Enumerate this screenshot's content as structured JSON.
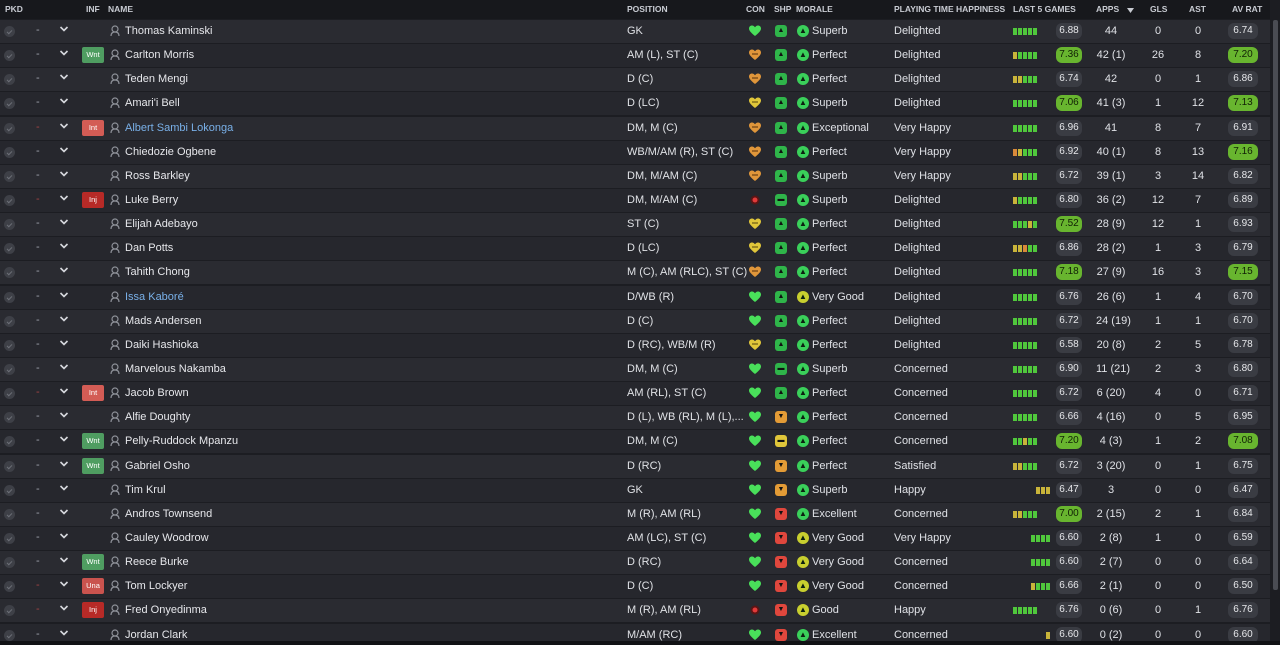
{
  "headers": {
    "pkd": "PKD",
    "inf": "INF",
    "name": "NAME",
    "position": "POSITION",
    "con": "CON",
    "shp": "SHP",
    "morale": "MORALE",
    "pth": "PLAYING TIME HAPPINESS",
    "form": "LAST 5 GAMES",
    "apps": "APPS",
    "sort_icon": "sort-desc-icon",
    "gls": "GLS",
    "ast": "AST",
    "avrat": "AV RAT"
  },
  "colors": {
    "form_green": "#50c83c",
    "form_yellow": "#c9b43a",
    "form_orange": "#d98a3a",
    "highlight_rating": "#68b52f",
    "link_name": "#79b0e8"
  },
  "players": [
    {
      "sel": "-",
      "inf": "",
      "name": "Thomas Kaminski",
      "link": false,
      "pos": "GK",
      "con": "heart-green",
      "shp": "up-green",
      "mor": "Superb",
      "mor_icon": "up-green",
      "pth": "Delighted",
      "form": [
        "g",
        "g",
        "g",
        "g",
        "g"
      ],
      "fval": "6.88",
      "fhi": false,
      "apps": "44",
      "gls": "0",
      "ast": "0",
      "rat": "6.74",
      "rhi": false
    },
    {
      "sel": "-",
      "inf": "Wnt",
      "name": "Carlton Morris",
      "link": false,
      "pos": "AM (L), ST (C)",
      "con": "heart-orange",
      "shp": "up-green",
      "mor": "Perfect",
      "mor_icon": "up-up-green",
      "pth": "Delighted",
      "form": [
        "y",
        "g",
        "g",
        "g",
        "g"
      ],
      "fval": "7.36",
      "fhi": true,
      "apps": "42 (1)",
      "gls": "26",
      "ast": "8",
      "rat": "7.20",
      "rhi": true
    },
    {
      "sel": "-",
      "inf": "",
      "name": "Teden Mengi",
      "link": false,
      "pos": "D (C)",
      "con": "heart-orange",
      "shp": "up-green",
      "mor": "Perfect",
      "mor_icon": "up-up-green",
      "pth": "Delighted",
      "form": [
        "y",
        "y",
        "g",
        "g",
        "g"
      ],
      "fval": "6.74",
      "fhi": false,
      "apps": "42",
      "gls": "0",
      "ast": "1",
      "rat": "6.86",
      "rhi": false
    },
    {
      "sel": "-",
      "inf": "",
      "name": "Amari'i Bell",
      "link": false,
      "pos": "D (LC)",
      "con": "heart-yellow",
      "shp": "up-green",
      "mor": "Superb",
      "mor_icon": "up-green",
      "pth": "Delighted",
      "form": [
        "g",
        "g",
        "g",
        "g",
        "g"
      ],
      "fval": "7.06",
      "fhi": true,
      "apps": "41 (3)",
      "gls": "1",
      "ast": "12",
      "rat": "7.13",
      "rhi": true
    },
    {
      "sel": "-",
      "inf": "Int",
      "name": "Albert Sambi Lokonga",
      "link": true,
      "pos": "DM, M (C)",
      "con": "heart-orange",
      "shp": "up-green",
      "mor": "Exceptional",
      "mor_icon": "up-up-green",
      "pth": "Very Happy",
      "form": [
        "g",
        "g",
        "g",
        "g",
        "g"
      ],
      "fval": "6.96",
      "fhi": false,
      "apps": "41",
      "gls": "8",
      "ast": "7",
      "rat": "6.91",
      "rhi": false
    },
    {
      "sel": "-",
      "inf": "",
      "name": "Chiedozie Ogbene",
      "link": false,
      "pos": "WB/M/AM (R), ST (C)",
      "con": "heart-orange",
      "shp": "up-green",
      "mor": "Perfect",
      "mor_icon": "up-up-green",
      "pth": "Very Happy",
      "form": [
        "o",
        "y",
        "g",
        "g",
        "g"
      ],
      "fval": "6.92",
      "fhi": false,
      "apps": "40 (1)",
      "gls": "8",
      "ast": "13",
      "rat": "7.16",
      "rhi": true
    },
    {
      "sel": "-",
      "inf": "",
      "name": "Ross Barkley",
      "link": false,
      "pos": "DM, M/AM (C)",
      "con": "heart-orange",
      "shp": "up-green",
      "mor": "Superb",
      "mor_icon": "up-green",
      "pth": "Very Happy",
      "form": [
        "y",
        "y",
        "g",
        "g",
        "g"
      ],
      "fval": "6.72",
      "fhi": false,
      "apps": "39 (1)",
      "gls": "3",
      "ast": "14",
      "rat": "6.82",
      "rhi": false
    },
    {
      "sel": "-",
      "inf": "Inj",
      "name": "Luke Berry",
      "link": false,
      "pos": "DM, M/AM (C)",
      "con": "injury-red",
      "shp": "flat-green",
      "mor": "Superb",
      "mor_icon": "up-green",
      "pth": "Delighted",
      "form": [
        "y",
        "g",
        "g",
        "g",
        "g"
      ],
      "fval": "6.80",
      "fhi": false,
      "apps": "36 (2)",
      "gls": "12",
      "ast": "7",
      "rat": "6.89",
      "rhi": false
    },
    {
      "sel": "-",
      "inf": "",
      "name": "Elijah Adebayo",
      "link": false,
      "pos": "ST (C)",
      "con": "heart-yellow",
      "shp": "up-green",
      "mor": "Perfect",
      "mor_icon": "up-up-green",
      "pth": "Delighted",
      "form": [
        "g",
        "g",
        "g",
        "y",
        "g"
      ],
      "fval": "7.52",
      "fhi": true,
      "apps": "28 (9)",
      "gls": "12",
      "ast": "1",
      "rat": "6.93",
      "rhi": false
    },
    {
      "sel": "-",
      "inf": "",
      "name": "Dan Potts",
      "link": false,
      "pos": "D (LC)",
      "con": "heart-yellow",
      "shp": "up-green",
      "mor": "Perfect",
      "mor_icon": "up-up-green",
      "pth": "Delighted",
      "form": [
        "y",
        "y",
        "o",
        "g",
        "g"
      ],
      "fval": "6.86",
      "fhi": false,
      "apps": "28 (2)",
      "gls": "1",
      "ast": "3",
      "rat": "6.79",
      "rhi": false
    },
    {
      "sel": "-",
      "inf": "",
      "name": "Tahith Chong",
      "link": false,
      "pos": "M (C), AM (RLC), ST (C)",
      "con": "heart-orange",
      "shp": "up-green",
      "mor": "Perfect",
      "mor_icon": "up-up-green",
      "pth": "Delighted",
      "form": [
        "g",
        "g",
        "g",
        "g",
        "g"
      ],
      "fval": "7.18",
      "fhi": true,
      "apps": "27 (9)",
      "gls": "16",
      "ast": "3",
      "rat": "7.15",
      "rhi": true
    },
    {
      "sel": "-",
      "inf": "",
      "name": "Issa Kaboré",
      "link": true,
      "pos": "D/WB (R)",
      "con": "heart-green",
      "shp": "up-green",
      "mor": "Very Good",
      "mor_icon": "up-yellow",
      "pth": "Delighted",
      "form": [
        "g",
        "g",
        "g",
        "g",
        "g"
      ],
      "fval": "6.76",
      "fhi": false,
      "apps": "26 (6)",
      "gls": "1",
      "ast": "4",
      "rat": "6.70",
      "rhi": false
    },
    {
      "sel": "-",
      "inf": "",
      "name": "Mads Andersen",
      "link": false,
      "pos": "D (C)",
      "con": "heart-green",
      "shp": "up-green",
      "mor": "Perfect",
      "mor_icon": "up-up-green",
      "pth": "Delighted",
      "form": [
        "g",
        "g",
        "g",
        "g",
        "g"
      ],
      "fval": "6.72",
      "fhi": false,
      "apps": "24 (19)",
      "gls": "1",
      "ast": "1",
      "rat": "6.70",
      "rhi": false
    },
    {
      "sel": "-",
      "inf": "",
      "name": "Daiki Hashioka",
      "link": false,
      "pos": "D (RC), WB/M (R)",
      "con": "heart-yellow",
      "shp": "up-green",
      "mor": "Perfect",
      "mor_icon": "up-up-green",
      "pth": "Delighted",
      "form": [
        "g",
        "g",
        "g",
        "g",
        "g"
      ],
      "fval": "6.58",
      "fhi": false,
      "apps": "20 (8)",
      "gls": "2",
      "ast": "5",
      "rat": "6.78",
      "rhi": false
    },
    {
      "sel": "-",
      "inf": "",
      "name": "Marvelous Nakamba",
      "link": false,
      "pos": "DM, M (C)",
      "con": "heart-green",
      "shp": "flat-green",
      "mor": "Superb",
      "mor_icon": "up-green",
      "pth": "Concerned",
      "form": [
        "g",
        "g",
        "g",
        "g",
        "g"
      ],
      "fval": "6.90",
      "fhi": false,
      "apps": "11 (21)",
      "gls": "2",
      "ast": "3",
      "rat": "6.80",
      "rhi": false
    },
    {
      "sel": "-",
      "inf": "Int",
      "name": "Jacob Brown",
      "link": false,
      "pos": "AM (RL), ST (C)",
      "con": "heart-green",
      "shp": "up-green",
      "mor": "Perfect",
      "mor_icon": "up-up-green",
      "pth": "Concerned",
      "form": [
        "g",
        "g",
        "g",
        "g",
        "g"
      ],
      "fval": "6.72",
      "fhi": false,
      "apps": "6 (20)",
      "gls": "4",
      "ast": "0",
      "rat": "6.71",
      "rhi": false
    },
    {
      "sel": "-",
      "inf": "",
      "name": "Alfie Doughty",
      "link": false,
      "pos": "D (L), WB (RL), M (L),...",
      "con": "heart-green",
      "shp": "down-orange",
      "mor": "Perfect",
      "mor_icon": "up-up-green",
      "pth": "Concerned",
      "form": [
        "g",
        "g",
        "g",
        "g",
        "g"
      ],
      "fval": "6.66",
      "fhi": false,
      "apps": "4 (16)",
      "gls": "0",
      "ast": "5",
      "rat": "6.95",
      "rhi": false
    },
    {
      "sel": "-",
      "inf": "Wnt",
      "name": "Pelly-Ruddock Mpanzu",
      "link": false,
      "pos": "DM, M (C)",
      "con": "heart-green",
      "shp": "flat-yellow",
      "mor": "Perfect",
      "mor_icon": "up-up-green",
      "pth": "Concerned",
      "form": [
        "g",
        "g",
        "y",
        "g",
        "g"
      ],
      "fval": "7.20",
      "fhi": true,
      "apps": "4 (3)",
      "gls": "1",
      "ast": "2",
      "rat": "7.08",
      "rhi": true
    },
    {
      "sel": "-",
      "inf": "Wnt",
      "name": "Gabriel Osho",
      "link": false,
      "pos": "D (RC)",
      "con": "heart-green",
      "shp": "down-orange",
      "mor": "Perfect",
      "mor_icon": "up-up-green",
      "pth": "Satisfied",
      "form": [
        "y",
        "y",
        "g",
        "g",
        "g"
      ],
      "fval": "6.72",
      "fhi": false,
      "apps": "3 (20)",
      "gls": "0",
      "ast": "1",
      "rat": "6.75",
      "rhi": false
    },
    {
      "sel": "-",
      "inf": "",
      "name": "Tim Krul",
      "link": false,
      "pos": "GK",
      "con": "heart-green",
      "shp": "down-orange",
      "mor": "Superb",
      "mor_icon": "up-green",
      "pth": "Happy",
      "form": [
        "y",
        "y",
        "y"
      ],
      "fval": "6.47",
      "fhi": false,
      "apps": "3",
      "gls": "0",
      "ast": "0",
      "rat": "6.47",
      "rhi": false
    },
    {
      "sel": "-",
      "inf": "",
      "name": "Andros Townsend",
      "link": false,
      "pos": "M (R), AM (RL)",
      "con": "heart-green",
      "shp": "down-red",
      "mor": "Excellent",
      "mor_icon": "up-green",
      "pth": "Concerned",
      "form": [
        "y",
        "y",
        "g",
        "g",
        "g"
      ],
      "fval": "7.00",
      "fhi": true,
      "apps": "2 (15)",
      "gls": "2",
      "ast": "1",
      "rat": "6.84",
      "rhi": false
    },
    {
      "sel": "-",
      "inf": "",
      "name": "Cauley Woodrow",
      "link": false,
      "pos": "AM (LC), ST (C)",
      "con": "heart-green",
      "shp": "down-red",
      "mor": "Very Good",
      "mor_icon": "up-yellow",
      "pth": "Very Happy",
      "form": [
        "g",
        "g",
        "g",
        "g"
      ],
      "fval": "6.60",
      "fhi": false,
      "apps": "2 (8)",
      "gls": "1",
      "ast": "0",
      "rat": "6.59",
      "rhi": false
    },
    {
      "sel": "-",
      "inf": "Wnt",
      "name": "Reece Burke",
      "link": false,
      "pos": "D (RC)",
      "con": "heart-green",
      "shp": "down-red",
      "mor": "Very Good",
      "mor_icon": "up-yellow",
      "pth": "Concerned",
      "form": [
        "g",
        "g",
        "g",
        "g"
      ],
      "fval": "6.60",
      "fhi": false,
      "apps": "2 (7)",
      "gls": "0",
      "ast": "0",
      "rat": "6.64",
      "rhi": false
    },
    {
      "sel": "-",
      "inf": "Una",
      "name": "Tom Lockyer",
      "link": false,
      "pos": "D (C)",
      "con": "heart-green",
      "shp": "down-red",
      "mor": "Very Good",
      "mor_icon": "up-yellow",
      "pth": "Concerned",
      "form": [
        "y",
        "g",
        "g",
        "g"
      ],
      "fval": "6.66",
      "fhi": false,
      "apps": "2 (1)",
      "gls": "0",
      "ast": "0",
      "rat": "6.50",
      "rhi": false
    },
    {
      "sel": "-",
      "inf": "Inj",
      "name": "Fred Onyedinma",
      "link": false,
      "pos": "M (R), AM (RL)",
      "con": "injury-red",
      "shp": "down-red",
      "mor": "Good",
      "mor_icon": "up-yellow",
      "pth": "Happy",
      "form": [
        "g",
        "g",
        "g",
        "g",
        "g"
      ],
      "fval": "6.76",
      "fhi": false,
      "apps": "0 (6)",
      "gls": "0",
      "ast": "1",
      "rat": "6.76",
      "rhi": false
    },
    {
      "sel": "-",
      "inf": "",
      "name": "Jordan Clark",
      "link": false,
      "pos": "M/AM (RC)",
      "con": "heart-green",
      "shp": "down-red",
      "mor": "Excellent",
      "mor_icon": "up-green",
      "pth": "Concerned",
      "form": [
        "y"
      ],
      "fval": "6.60",
      "fhi": false,
      "apps": "0 (2)",
      "gls": "0",
      "ast": "0",
      "rat": "6.60",
      "rhi": false
    }
  ]
}
